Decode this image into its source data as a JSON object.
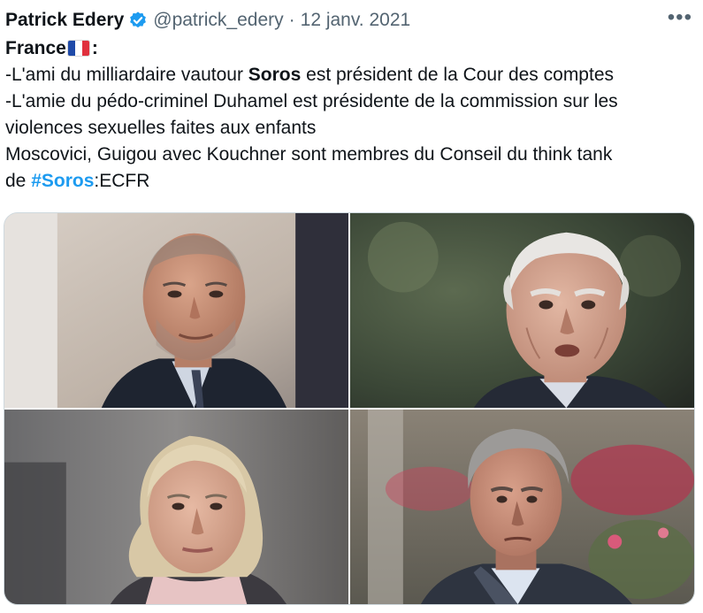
{
  "author": {
    "name": "Patrick Edery",
    "handle": "@patrick_edery",
    "separator": "·",
    "date": "12 janv. 2021",
    "verified_icon": "verified-badge-icon",
    "verified_color": "#1d9bf0"
  },
  "more_label": "•••",
  "tweet": {
    "l1": "France",
    "l1_suffix": ":",
    "l2_pre": "-L'ami du milliardaire vautour ",
    "l2_bold": "Soros",
    "l2_post": " est président de la Cour des comptes",
    "l3": "-L'amie du pédo-criminel Duhamel est présidente de la commission sur les",
    "l4": "violences sexuelles faites aux enfants",
    "l5": "Moscovici, Guigou avec Kouchner sont membres du Conseil du think tank",
    "l6_pre": "de ",
    "l6_hashtag": "#Soros",
    "l6_post": ":ECFR"
  },
  "colors": {
    "text": "#0f1419",
    "muted": "#536471",
    "link": "#1d9bf0"
  }
}
